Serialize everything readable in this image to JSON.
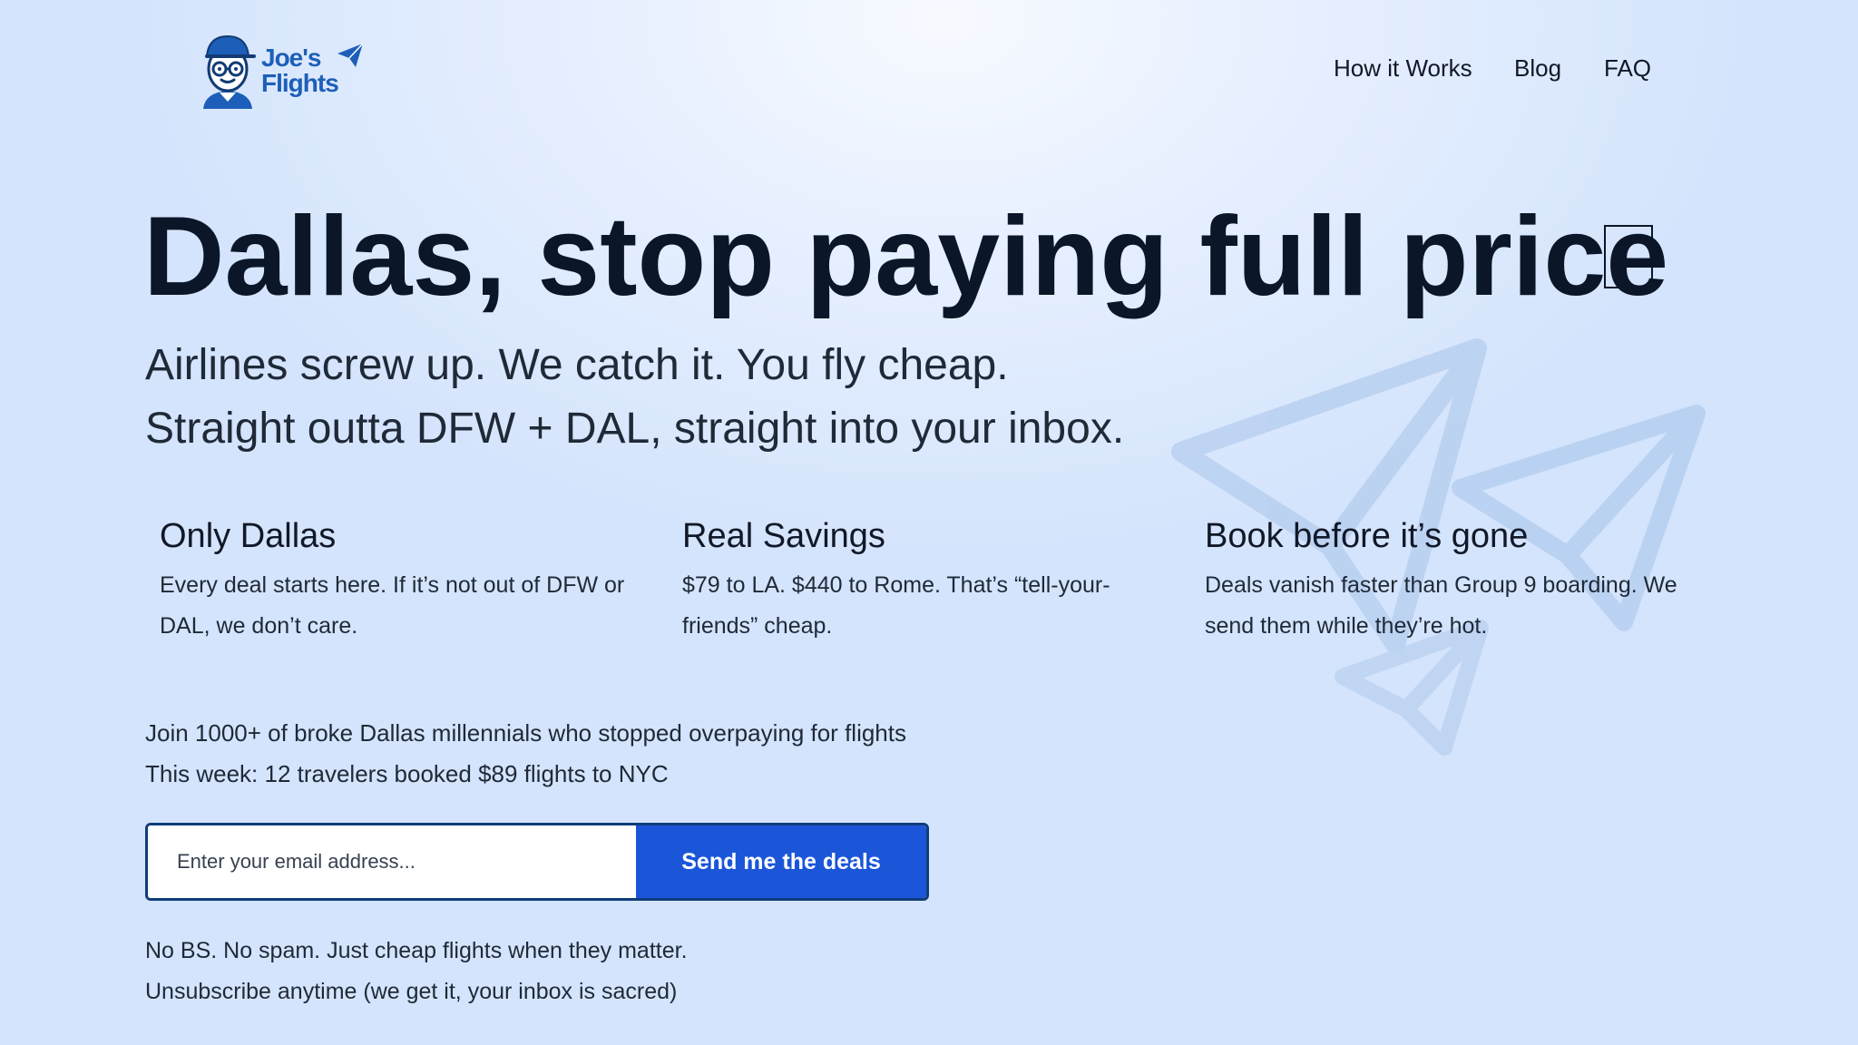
{
  "brand": {
    "line1": "Joe's",
    "line2": "Flights"
  },
  "nav": {
    "items": [
      "How it Works",
      "Blog",
      "FAQ"
    ]
  },
  "hero": {
    "title": "Dallas, stop paying full price",
    "subtitle_line1": "Airlines screw up. We catch it. You fly cheap.",
    "subtitle_line2": "Straight outta DFW + DAL, straight into your inbox."
  },
  "features": [
    {
      "title": "Only Dallas",
      "text": "Every deal starts here. If it’s not out of DFW or DAL, we don’t care."
    },
    {
      "title": "Real Savings",
      "text": "$79 to LA. $440 to Rome. That’s “tell-your-friends” cheap."
    },
    {
      "title": "Book before it’s gone",
      "text": "Deals vanish faster than Group 9 boarding. We send them while they’re hot."
    }
  ],
  "social_proof": {
    "line1": "Join 1000+ of broke Dallas millennials who stopped overpaying for flights",
    "line2": "This week: 12 travelers booked $89 flights to NYC"
  },
  "signup": {
    "email_placeholder": "Enter your email address...",
    "button_label": "Send me the deals"
  },
  "footer_note": {
    "line1": "No BS. No spam. Just cheap flights when they matter.",
    "line2": "Unsubscribe anytime (we get it, your inbox is sacred)"
  },
  "icons": {
    "logo": "joe-avatar-icon",
    "logo_plane": "paper-plane-icon",
    "decoration": "paper-planes-illustration",
    "missing_glyph": "missing-emoji-glyph"
  },
  "colors": {
    "brand_blue": "#1d5fb8",
    "button_blue": "#1b56d9",
    "title": "#0b1628"
  }
}
